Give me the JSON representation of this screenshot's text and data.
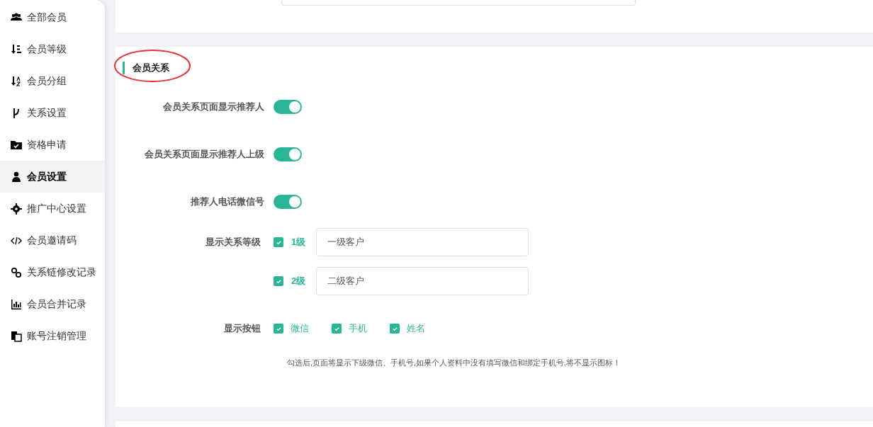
{
  "sidebar": {
    "items": [
      {
        "label": "全部会员",
        "selected": false
      },
      {
        "label": "会员等级",
        "selected": false
      },
      {
        "label": "会员分组",
        "selected": false
      },
      {
        "label": "关系设置",
        "selected": false
      },
      {
        "label": "资格申请",
        "selected": false
      },
      {
        "label": "会员设置",
        "selected": true
      },
      {
        "label": "推广中心设置",
        "selected": false
      },
      {
        "label": "会员邀请码",
        "selected": false
      },
      {
        "label": "关系链修改记录",
        "selected": false
      },
      {
        "label": "会员合并记录",
        "selected": false
      },
      {
        "label": "账号注销管理",
        "selected": false
      }
    ]
  },
  "section": {
    "title": "会员关系",
    "toggles": [
      {
        "label": "会员关系页面显示推荐人",
        "on": true
      },
      {
        "label": "会员关系页面显示推荐人上级",
        "on": true
      },
      {
        "label": "推荐人电话微信号",
        "on": true
      }
    ],
    "levels_label": "显示关系等级",
    "levels": [
      {
        "label": "1级",
        "checked": true,
        "value": "一级客户"
      },
      {
        "label": "2级",
        "checked": true,
        "value": "二级客户"
      }
    ],
    "buttons_label": "显示按钮",
    "buttons": [
      {
        "label": "微信",
        "checked": true
      },
      {
        "label": "手机",
        "checked": true
      },
      {
        "label": "姓名",
        "checked": true
      }
    ],
    "note": "勾选后,页面将显示下级微信、手机号,如果个人资料中没有填写微信和绑定手机号,将不显示图标！"
  }
}
